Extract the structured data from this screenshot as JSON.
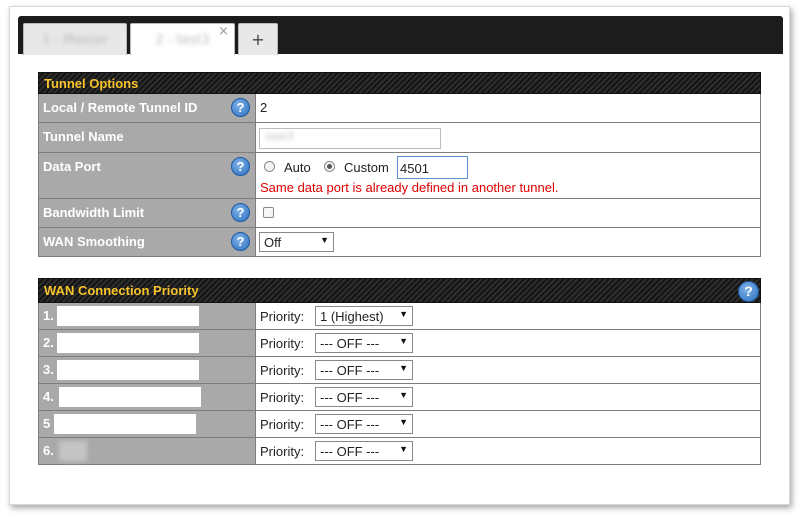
{
  "tabs": [
    {
      "label": "1 - Master"
    },
    {
      "label": "2 - test3",
      "close": "×"
    },
    {
      "label": "+"
    }
  ],
  "tunnel_options": {
    "title": "Tunnel Options",
    "help_glyph": "?",
    "rows": {
      "tunnel_id": {
        "label": "Local / Remote Tunnel ID",
        "value": "2"
      },
      "tunnel_name": {
        "label": "Tunnel Name",
        "value": "test3"
      },
      "data_port": {
        "label": "Data Port",
        "option_auto": "Auto",
        "option_custom": "Custom",
        "selected": "Custom",
        "port_value": "4501",
        "error": "Same data port is already defined in another tunnel."
      },
      "bandwidth_limit": {
        "label": "Bandwidth Limit",
        "checked": false
      },
      "wan_smoothing": {
        "label": "WAN Smoothing",
        "value": "Off"
      }
    }
  },
  "wan_priority": {
    "title": "WAN Connection Priority",
    "help_glyph": "?",
    "priority_label": "Priority:",
    "rows": [
      {
        "num": "1.",
        "priority": "1 (Highest)"
      },
      {
        "num": "2.",
        "priority": "--- OFF ---"
      },
      {
        "num": "3.",
        "priority": "--- OFF ---"
      },
      {
        "num": "4.",
        "priority": "--- OFF ---"
      },
      {
        "num": "5",
        "priority": "--- OFF ---"
      },
      {
        "num": "6.",
        "priority": "--- OFF ---"
      }
    ]
  },
  "colors": {
    "header_text": "#f7c32b",
    "label_bg": "#a9a9a9",
    "error": "#e00000",
    "help_blue": "#2c6fbf"
  }
}
